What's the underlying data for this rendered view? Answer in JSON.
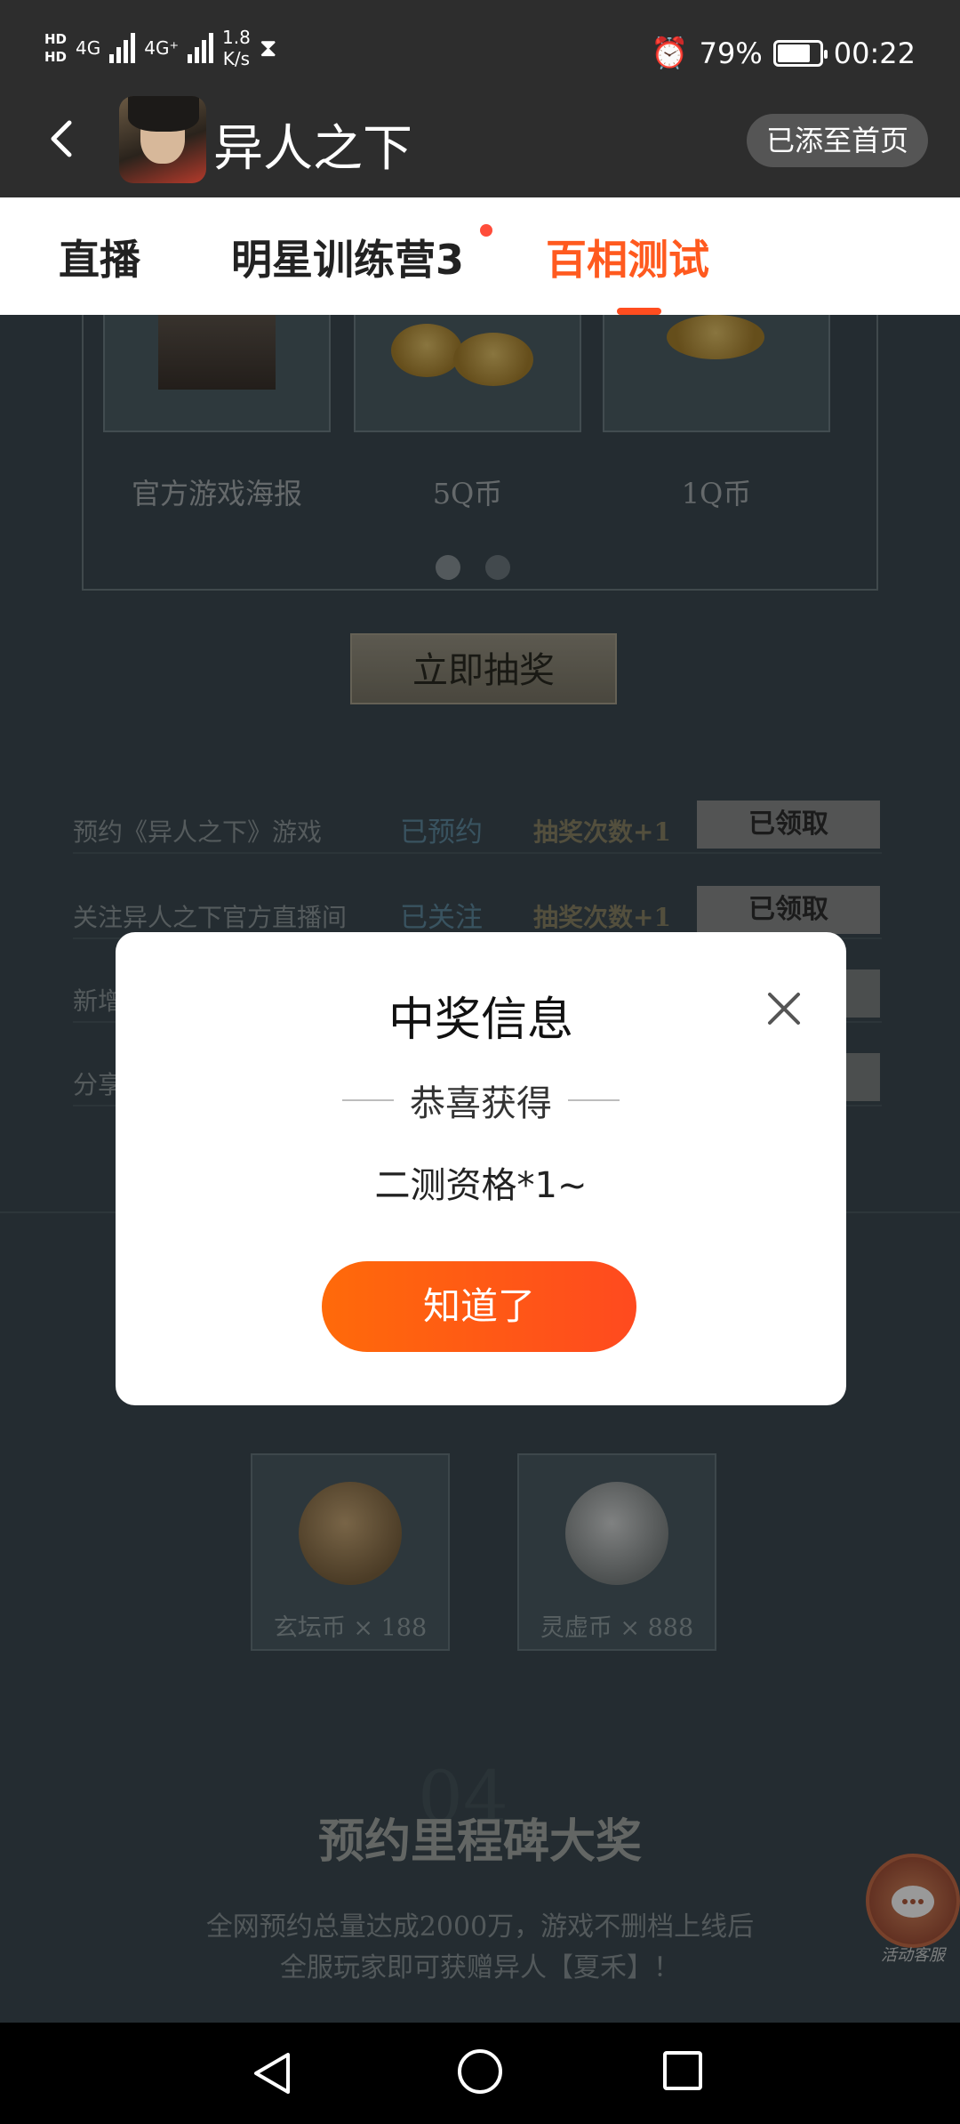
{
  "status_bar": {
    "network_hd_top": "HD",
    "network_hd_bottom": "HD",
    "net1": "4G",
    "net2": "4G⁺",
    "speed_value": "1.8",
    "speed_unit": "K/s",
    "battery_percent": "79%",
    "time": "00:22",
    "battery_level": 0.79
  },
  "app_bar": {
    "title": "异人之下",
    "added_label": "已添至首页"
  },
  "tabs": [
    {
      "label": "直播",
      "active": false
    },
    {
      "label": "明星训练营3",
      "active": false,
      "has_dot": true
    },
    {
      "label": "百相测试",
      "active": true
    }
  ],
  "page": {
    "prizes": [
      {
        "label": "官方游戏海报"
      },
      {
        "label": "5Q币"
      },
      {
        "label": "1Q币"
      }
    ],
    "draw_button": "立即抽奖",
    "tasks": [
      {
        "name": "预约《异人之下》游戏",
        "status": "已预约",
        "reward": "抽奖次数+1",
        "button": "已领取"
      },
      {
        "name": "关注异人之下官方直播间",
        "status": "已关注",
        "reward": "抽奖次数+1",
        "button": "已领取"
      },
      {
        "name": "新增",
        "status": "",
        "reward": "",
        "button": ""
      },
      {
        "name": "分享",
        "status": "",
        "reward": "",
        "button": ""
      }
    ],
    "coins": [
      {
        "label": "玄坛币 × 188"
      },
      {
        "label": "灵虚币 × 888"
      }
    ],
    "milestone_number": "04",
    "milestone_title": "预约里程碑大奖",
    "milestone_desc_1": "全网预约总量达成2000万，游戏不删档上线后",
    "milestone_desc_2": "全服玩家即可获赠异人【夏禾】！",
    "support_label": "活动客服"
  },
  "modal": {
    "title": "中奖信息",
    "congrats": "恭喜获得",
    "prize": "二测资格*1~",
    "ok_button": "知道了"
  },
  "colors": {
    "accent": "#ff5a1f",
    "button_gradient_start": "#ff6a0a",
    "button_gradient_end": "#ff4a1f"
  }
}
